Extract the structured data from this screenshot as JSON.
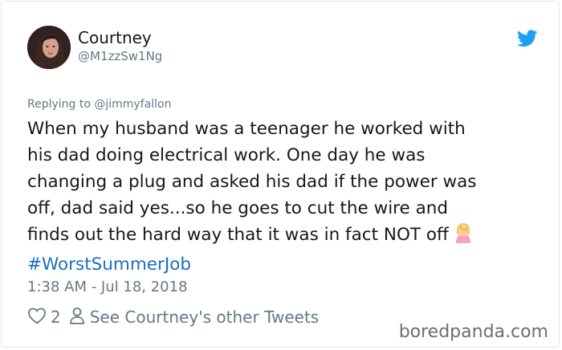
{
  "tweet": {
    "author": {
      "display_name": "Courtney",
      "handle": "@M1zzSw1Ng",
      "avatar_icon": "profile-photo"
    },
    "platform_icon": "twitter-bird-icon",
    "replying_to": "Replying to @jimmyfallon",
    "text_lines": [
      "When my husband was a teenager he worked with",
      "his dad doing electrical work. One day he was",
      "changing a plug and asked his dad if the power was",
      "off, dad said yes...so he goes to cut the wire and",
      "finds out the hard way that it was in fact NOT off"
    ],
    "emoji": "🤦‍♀️",
    "hashtag": "#WorstSummerJob",
    "timestamp": "1:38 AM - Jul 18, 2018",
    "likes": "2",
    "see_other_tweets": "See Courtney's other Tweets"
  },
  "watermark": "boredpanda.com",
  "colors": {
    "text": "#14171a",
    "secondary": "#657786",
    "link": "#1b6fbd",
    "twitter_blue": "#1da1f2",
    "border": "#e1e8ed"
  }
}
